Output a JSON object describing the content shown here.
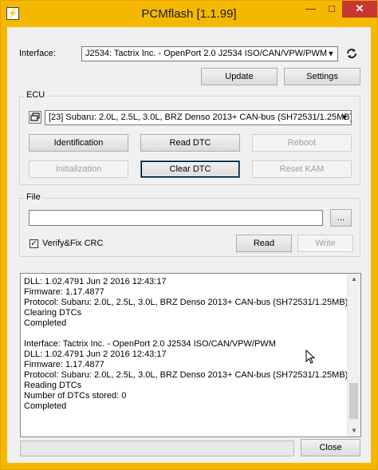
{
  "window": {
    "title": "PCMflash [1.1.99]",
    "app_icon": "⚡",
    "min_glyph": "—",
    "max_glyph": "□",
    "close_glyph": "✕"
  },
  "interface": {
    "label": "Interface:",
    "selected": "J2534: Tactrix Inc. - OpenPort 2.0 J2534 ISO/CAN/VPW/PWM",
    "refresh_icon": "refresh-icon",
    "update_label": "Update",
    "settings_label": "Settings"
  },
  "ecu": {
    "group_label": "ECU",
    "selected": "[23] Subaru: 2.0L, 2.5L, 3.0L, BRZ Denso 2013+ CAN-bus (SH72531/1.25MB)",
    "buttons": {
      "identification": "Identification",
      "read_dtc": "Read DTC",
      "reboot": "Reboot",
      "initialization": "Initialization",
      "clear_dtc": "Clear DTC",
      "reset_kam": "Reset KAM"
    }
  },
  "file": {
    "group_label": "File",
    "path_value": "",
    "browse_label": "...",
    "verify_label": "Verify&Fix CRC",
    "verify_checked": true,
    "read_label": "Read",
    "write_label": "Write"
  },
  "log": {
    "lines": [
      "DLL: 1.02.4791 Jun  2 2016 12:43:17",
      "Firmware: 1.17.4877",
      "Protocol: Subaru: 2.0L, 2.5L, 3.0L, BRZ Denso 2013+ CAN-bus (SH72531/1.25MB)",
      "Clearing DTCs",
      "Completed",
      "",
      "Interface: Tactrix Inc. - OpenPort 2.0 J2534 ISO/CAN/VPW/PWM",
      "DLL: 1.02.4791 Jun  2 2016 12:43:17",
      "Firmware: 1.17.4877",
      "Protocol: Subaru: 2.0L, 2.5L, 3.0L, BRZ Denso 2013+ CAN-bus (SH72531/1.25MB)",
      "Reading DTCs",
      "Number of DTCs stored: 0",
      "Completed"
    ]
  },
  "footer": {
    "close_label": "Close"
  }
}
